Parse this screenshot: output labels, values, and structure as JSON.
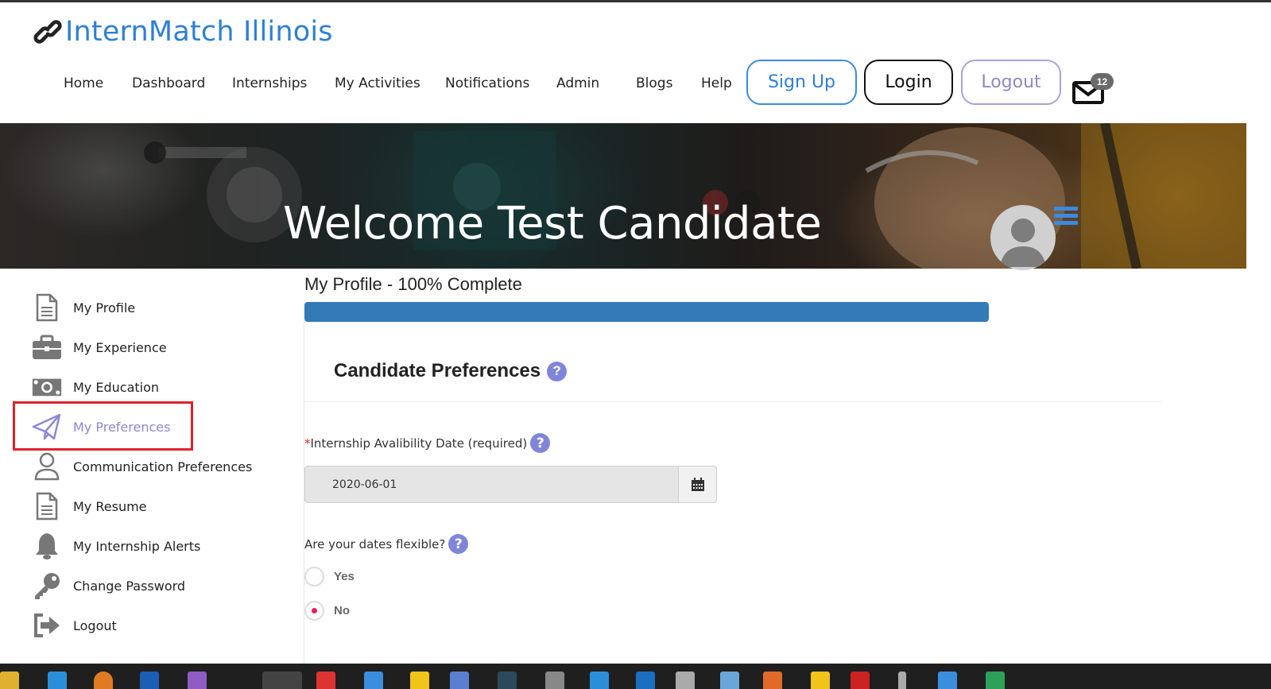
{
  "header": {
    "logo_text": "InternMatch Illinois",
    "nav": [
      {
        "label": "Home"
      },
      {
        "label": "Dashboard"
      },
      {
        "label": "Internships"
      },
      {
        "label": "My Activities"
      },
      {
        "label": "Notifications"
      },
      {
        "label": "Admin"
      },
      {
        "label": "Blogs"
      },
      {
        "label": "Help"
      }
    ],
    "signup_label": "Sign Up",
    "login_label": "Login",
    "logout_label": "Logout",
    "mail_count": "12"
  },
  "banner": {
    "welcome": "Welcome Test Candidate"
  },
  "sidebar": {
    "items": [
      {
        "label": "My Profile",
        "icon": "document-icon"
      },
      {
        "label": "My Experience",
        "icon": "briefcase-icon"
      },
      {
        "label": "My Education",
        "icon": "money-icon"
      },
      {
        "label": "My Preferences",
        "icon": "paper-plane-icon",
        "active": true
      },
      {
        "label": "Communication Preferences",
        "icon": "user-icon"
      },
      {
        "label": "My Resume",
        "icon": "document-icon"
      },
      {
        "label": "My Internship Alerts",
        "icon": "bell-icon"
      },
      {
        "label": "Change Password",
        "icon": "key-icon"
      },
      {
        "label": "Logout",
        "icon": "sign-out-icon"
      }
    ]
  },
  "main": {
    "progress_title": "My Profile - 100% Complete",
    "progress_percent": 100,
    "section_title": "Candidate Preferences",
    "availability": {
      "required_mark": "*",
      "label": "Internship Avalibility Date (required)",
      "value": "2020-06-01"
    },
    "flexible": {
      "label": "Are your dates flexible?",
      "options": [
        {
          "label": "Yes",
          "checked": false
        },
        {
          "label": "No",
          "checked": true
        }
      ]
    }
  },
  "colors": {
    "brand_blue": "#2f7fd3",
    "progress": "#337ab7",
    "active_item": "#8c88d4",
    "help_icon": "#7f86d9",
    "radio_checked": "#e91e63",
    "highlight": "#e0222c"
  }
}
